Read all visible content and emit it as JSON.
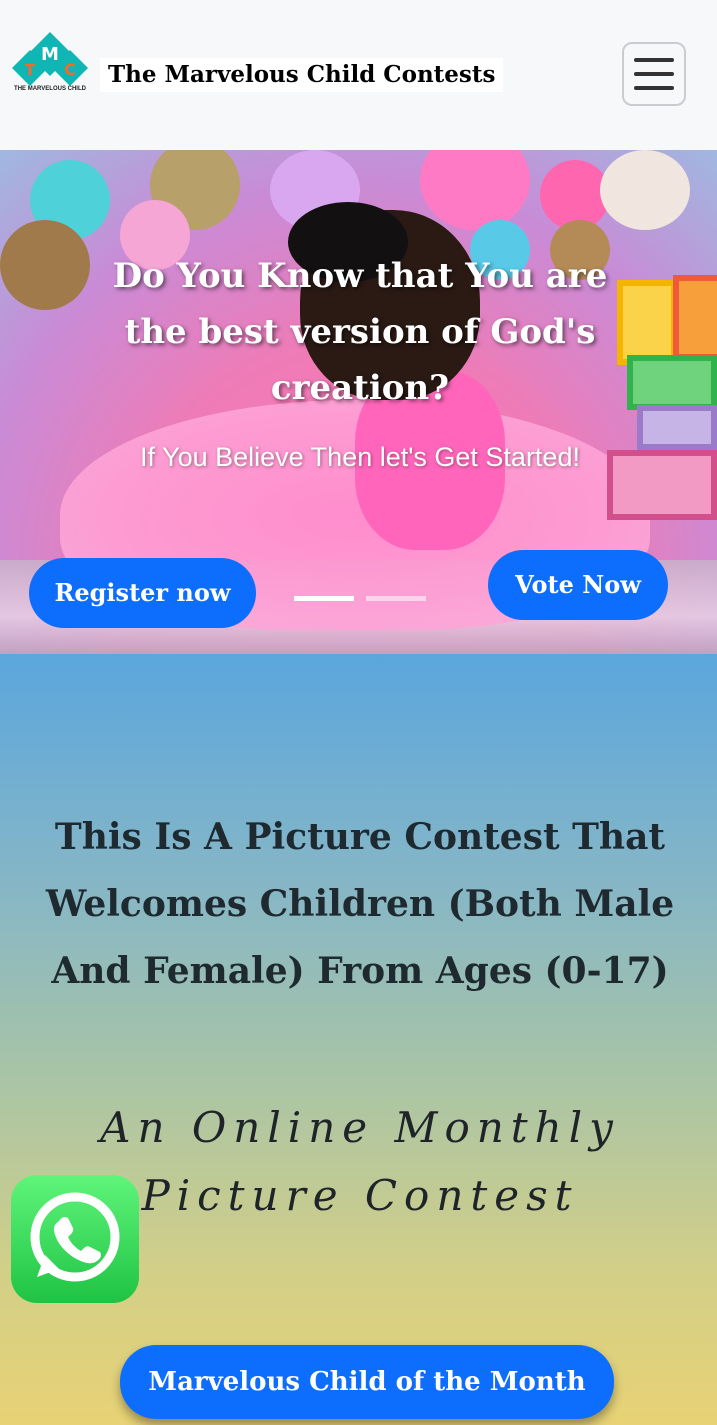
{
  "header": {
    "logo_letters": "MTC",
    "logo_caption": "THE MARVELOUS CHILD",
    "brand": "The Marvelous Child Contests",
    "menu_icon": "hamburger-icon"
  },
  "hero": {
    "heading": "Do You Know that You are the best version of God's creation?",
    "subheading": "If You Believe Then let's Get Started!",
    "register_label": "Register now",
    "vote_label": "Vote Now",
    "slide_count": 2,
    "active_slide": 1
  },
  "info": {
    "title": "This Is A Picture Contest That Welcomes Children (Both Male And Female) From Ages (0-17)",
    "subtitle": "An Online Monthly Picture Contest",
    "cta_label": "Marvelous Child of the Month",
    "whatsapp_icon": "whatsapp-icon"
  },
  "colors": {
    "primary": "#0d6efd",
    "whatsapp": "#25d366"
  }
}
